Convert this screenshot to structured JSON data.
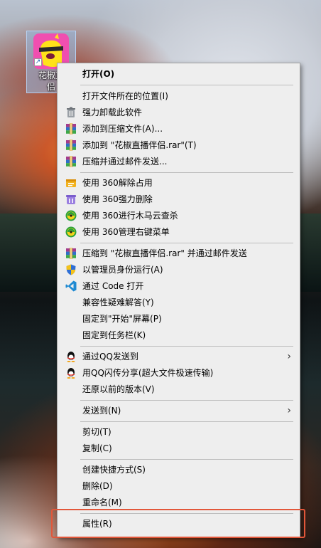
{
  "desktop": {
    "icon_label": "花椒直播伴侣",
    "icon_label_visible_line1": "花椒直",
    "icon_label_visible_line2": "侣"
  },
  "menu": {
    "items": [
      {
        "label": "打开(O)",
        "icon": "",
        "bold": true
      },
      {
        "label": "打开文件所在的位置(I)",
        "icon": ""
      },
      {
        "label": "强力卸载此软件",
        "icon": "trash-icon"
      },
      {
        "label": "添加到压缩文件(A)...",
        "icon": "winrar-icon"
      },
      {
        "label": "添加到 \"花椒直播伴侣.rar\"(T)",
        "icon": "winrar-icon"
      },
      {
        "label": "压缩并通过邮件发送...",
        "icon": "winrar-icon"
      },
      {
        "label": "使用 360解除占用",
        "icon": "360-unlock-icon"
      },
      {
        "label": "使用 360强力删除",
        "icon": "360-delete-icon"
      },
      {
        "label": "使用 360进行木马云查杀",
        "icon": "360-icon"
      },
      {
        "label": "使用 360管理右键菜单",
        "icon": "360-icon"
      },
      {
        "label": "压缩到 \"花椒直播伴侣.rar\" 并通过邮件发送",
        "icon": "winrar-icon"
      },
      {
        "label": "以管理员身份运行(A)",
        "icon": "uac-shield-icon"
      },
      {
        "label": "通过 Code 打开",
        "icon": "vscode-icon"
      },
      {
        "label": "兼容性疑难解答(Y)",
        "icon": ""
      },
      {
        "label": "固定到\"开始\"屏幕(P)",
        "icon": ""
      },
      {
        "label": "固定到任务栏(K)",
        "icon": ""
      },
      {
        "label": "通过QQ发送到",
        "icon": "qq-icon",
        "submenu": true
      },
      {
        "label": "用QQ闪传分享(超大文件极速传输)",
        "icon": "qq-icon"
      },
      {
        "label": "还原以前的版本(V)",
        "icon": ""
      },
      {
        "label": "发送到(N)",
        "icon": "",
        "submenu": true
      },
      {
        "label": "剪切(T)",
        "icon": ""
      },
      {
        "label": "复制(C)",
        "icon": ""
      },
      {
        "label": "创建快捷方式(S)",
        "icon": ""
      },
      {
        "label": "删除(D)",
        "icon": ""
      },
      {
        "label": "重命名(M)",
        "icon": ""
      },
      {
        "label": "属性(R)",
        "icon": ""
      }
    ],
    "submenu_arrow": "›"
  },
  "colors": {
    "menu_bg": "#eeeeee",
    "separator": "#bdbdbd",
    "highlight_border": "#e2573a"
  }
}
